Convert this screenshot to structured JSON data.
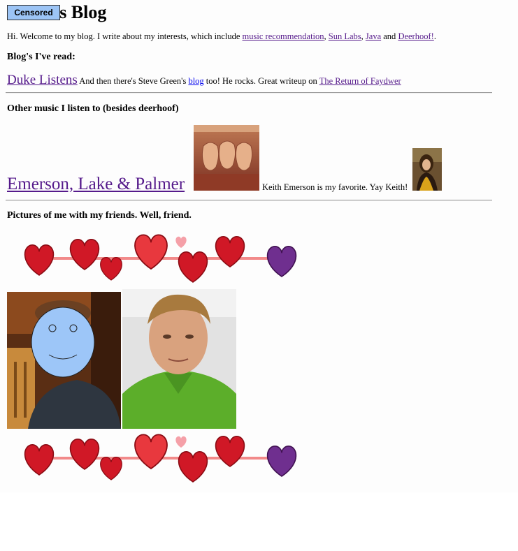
{
  "title": {
    "censor_label": "Censored",
    "suffix": "'s Blog"
  },
  "intro": {
    "text": "Hi. Welcome to my blog. I write about my interests, which include ",
    "links": [
      "music recommendation",
      "Sun Labs",
      "Java",
      "Deerhoof!"
    ],
    "sep1": ", ",
    "sep2": ", ",
    "sep3": " and ",
    "end": "."
  },
  "blogs": {
    "heading": "Blog's I've read:",
    "duke_link": "Duke Listens",
    "text1": " And then there's Steve Green's ",
    "blog_link": "blog",
    "text2": " too! He rocks. Great writeup on ",
    "faydwer_link": "The Return of Faydwer"
  },
  "music": {
    "heading": "Other music I listen to (besides deerhoof)",
    "band_link": "Emerson, Lake & Palmer",
    "keith_text": "Keith Emerson is my favorite. Yay Keith!"
  },
  "pictures": {
    "heading": "Pictures of me with my friends. Well, friend."
  },
  "colors": {
    "heart_red": "#d01826",
    "heart_purple": "#6f2f8f",
    "garland_line": "#f28a8a",
    "censor_blue": "#9cc4f5",
    "friend_shirt": "#5cae2a"
  }
}
